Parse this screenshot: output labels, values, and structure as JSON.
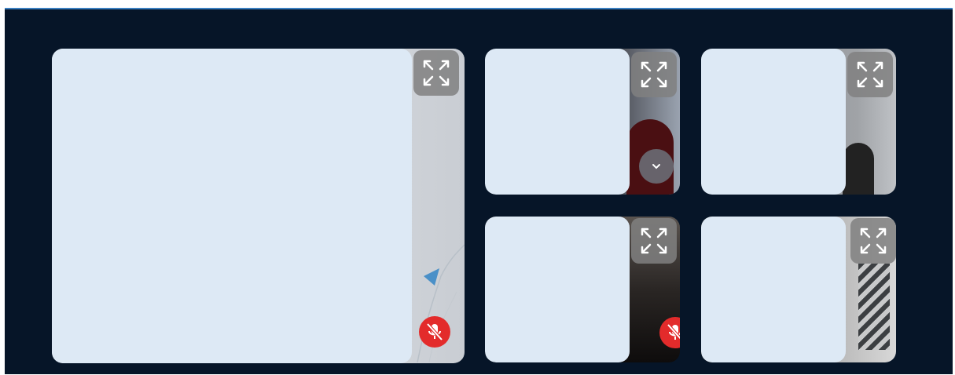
{
  "colors": {
    "background": "#061528",
    "tile_placeholder": "#dde9f5",
    "mute_badge": "#e32b2b",
    "expand_button": "#808080",
    "top_border": "#3a7fc1"
  },
  "participants": [
    {
      "id": "p1",
      "muted": true,
      "expand_icon": "expand-arrows-icon"
    },
    {
      "id": "p2",
      "muted": false,
      "has_more_button": true,
      "expand_icon": "expand-arrows-icon"
    },
    {
      "id": "p3",
      "muted": false,
      "expand_icon": "expand-arrows-icon"
    },
    {
      "id": "p4",
      "muted": true,
      "expand_icon": "expand-arrows-icon"
    },
    {
      "id": "p5",
      "muted": false,
      "expand_icon": "expand-arrows-icon"
    }
  ]
}
